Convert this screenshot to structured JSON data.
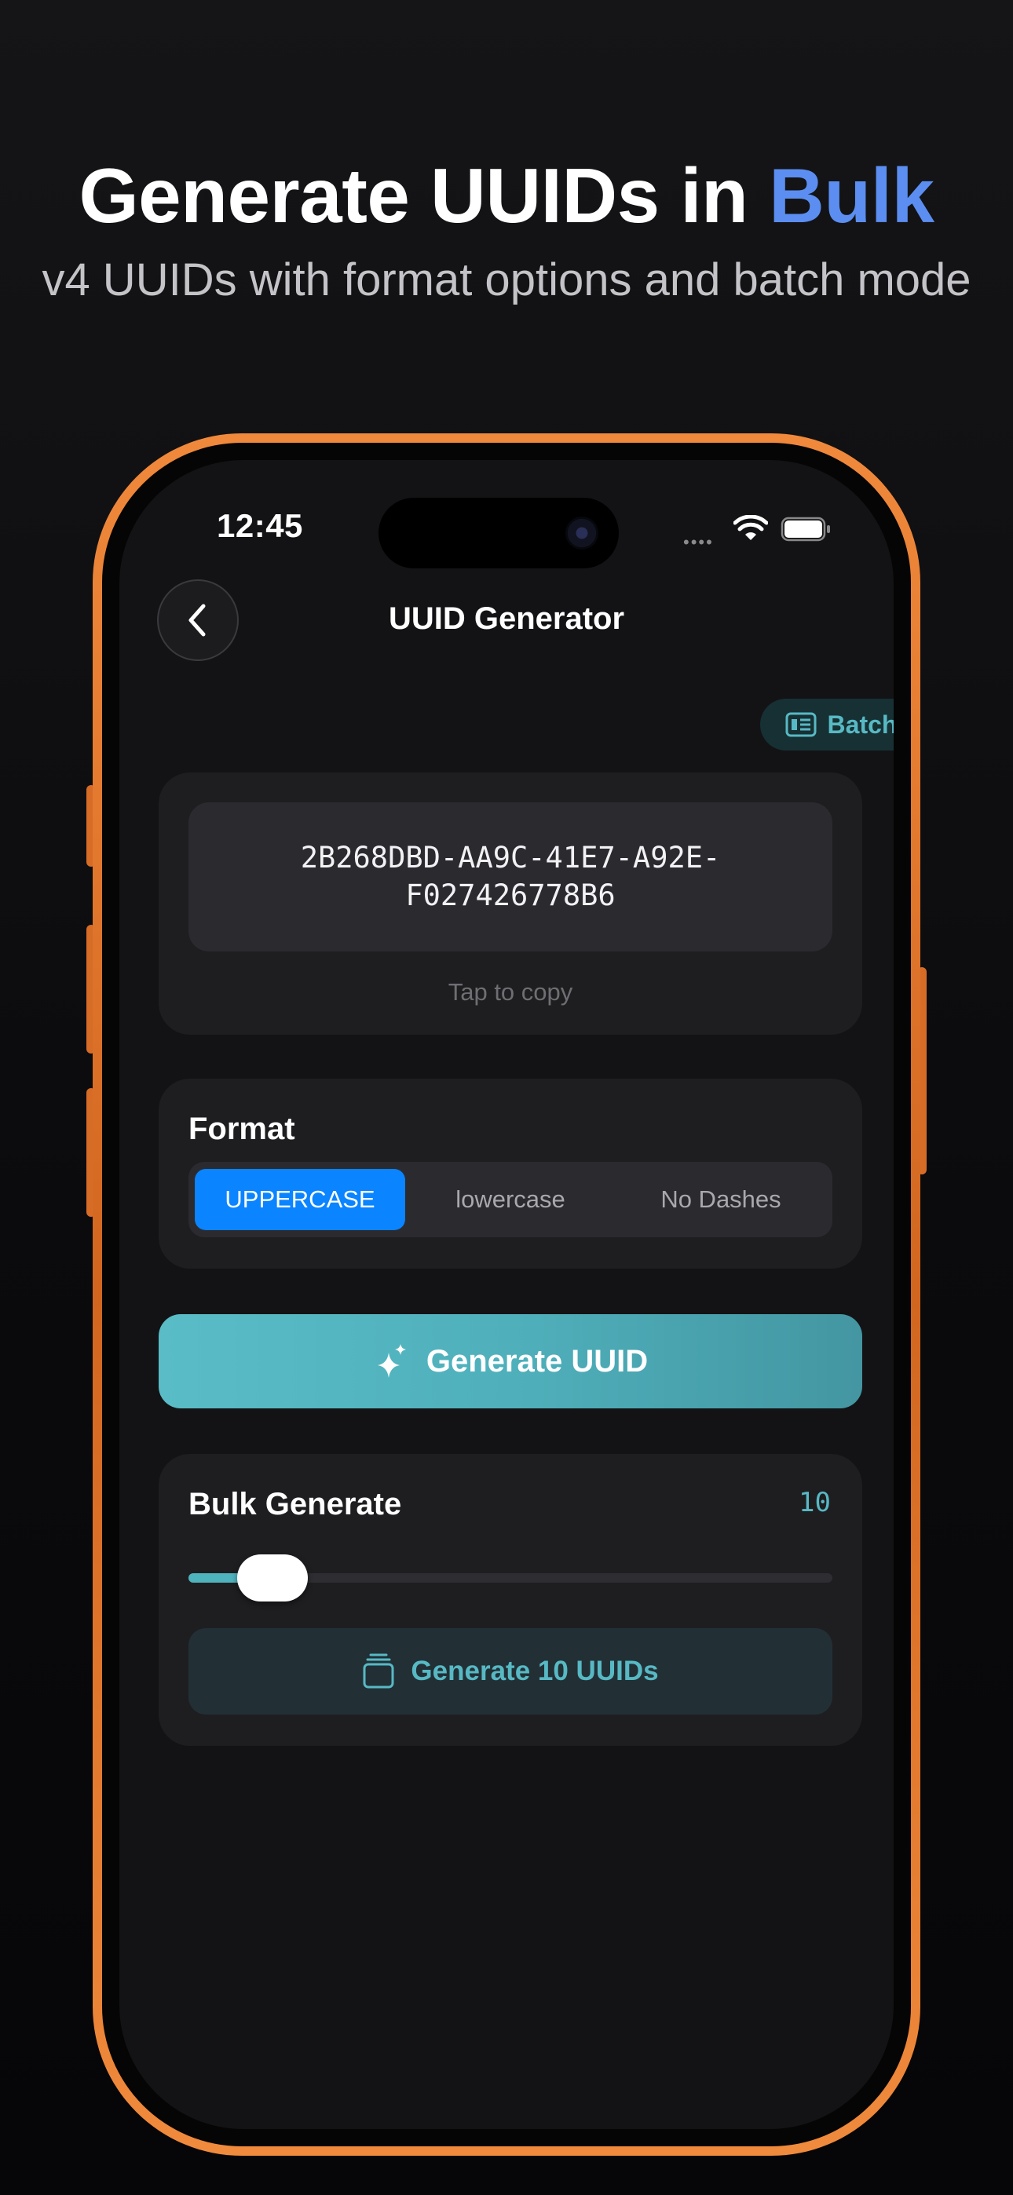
{
  "headline": {
    "prefix": "Generate UUIDs in ",
    "accent": "Bulk"
  },
  "subheadline": "v4 UUIDs with format options and batch mode",
  "status_bar": {
    "time": "12:45"
  },
  "nav": {
    "title": "UUID Generator",
    "batch_label": "Batch"
  },
  "uuid_display": {
    "line1": "2B268DBD-AA9C-41E7-A92E-",
    "line2": "F027426778B6",
    "hint": "Tap to copy"
  },
  "format": {
    "title": "Format",
    "options": [
      "UPPERCASE",
      "lowercase",
      "No Dashes"
    ],
    "selected": "UPPERCASE"
  },
  "generate_button": {
    "label": "Generate UUID"
  },
  "bulk": {
    "title": "Bulk Generate",
    "count": "10",
    "slider_fraction": 0.13,
    "button_label": "Generate 10 UUIDs"
  },
  "colors": {
    "accent": "#5b8ef0",
    "teal": "#57b9c4",
    "selected_segment": "#0a84ff",
    "phone_frame": "#e07a30"
  }
}
